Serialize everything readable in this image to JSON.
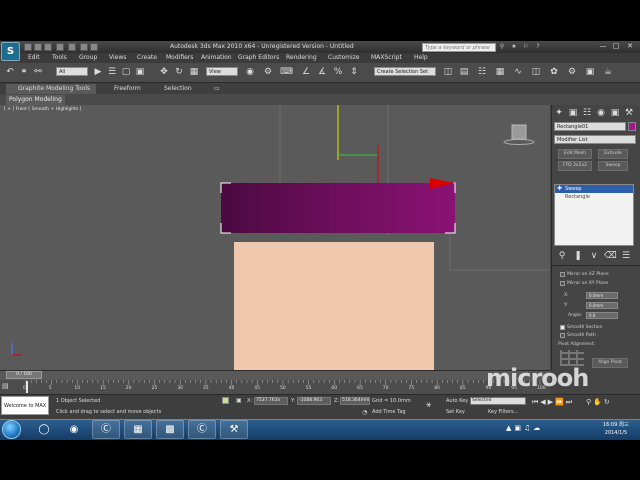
{
  "window": {
    "title": "Autodesk 3ds Max  2010 x64    - Unregistered Version -    Untitled",
    "search_placeholder": "Type a keyword or phrase"
  },
  "menu": [
    "Edit",
    "Tools",
    "Group",
    "Views",
    "Create",
    "Modifiers",
    "Animation",
    "Graph Editors",
    "Rendering",
    "Customize",
    "MAXScript",
    "Help"
  ],
  "toolbar": {
    "selection_filter": "All",
    "reference_coord": "View",
    "named_selection": "Create Selection Set"
  },
  "ribbon": {
    "tabs": [
      "Graphite Modeling Tools",
      "Freeform",
      "Selection"
    ],
    "active_subtab": "Polygon Modeling"
  },
  "viewport": {
    "label": "[ + ] Front [ Smooth + Highlights ]",
    "colors": {
      "background": "#5a5a5a",
      "sweep_object": "#6e0e5c",
      "box_object": "#f0c8ad",
      "gizmo_red": "#d90000"
    }
  },
  "command_panel": {
    "object_name": "Rectangle01",
    "modifier_list": "Modifier List",
    "buttons": [
      "Edit Mesh",
      "Extrude",
      "FFD 2x2x2",
      "Sweep"
    ],
    "stack": [
      {
        "label": "Sweep",
        "selected": true
      },
      {
        "label": "Rectangle",
        "selected": false
      }
    ],
    "params": {
      "mirror_xz": "Mirror on XZ Plane",
      "mirror_xy": "Mirror on XY Plane",
      "x_label": "X:",
      "x_value": "0.0mm",
      "y_label": "Y:",
      "y_value": "0.0mm",
      "angle_label": "Angle:",
      "angle_value": "0.0",
      "smooth_section": "Smooth Section",
      "smooth_path": "Smooth Path",
      "pivot_alignment": "Pivot Alignment:",
      "align_pivot": "Align Pivot"
    }
  },
  "timeline": {
    "slider_label": "0 / 100",
    "ticks": [
      "0",
      "5",
      "10",
      "15",
      "20",
      "25",
      "30",
      "35",
      "40",
      "45",
      "50",
      "55",
      "60",
      "65",
      "70",
      "75",
      "80",
      "85",
      "90",
      "95",
      "100"
    ]
  },
  "status": {
    "welcome": "Welcome to MAX",
    "selected": "1 Object Selected",
    "prompt": "Click and drag to select and move objects",
    "x": "7537.763n",
    "y": "-1088.963",
    "z": "518.364mm",
    "grid": "Grid = 10.0mm",
    "add_time_tag": "Add Time Tag",
    "auto_key": "Auto Key",
    "set_key": "Set Key",
    "key_mode": "Selected",
    "key_filters": "Key Filters..."
  },
  "watermark": "microoh",
  "taskbar": {
    "time": "16:09 周三",
    "date": "2014/1/5"
  }
}
